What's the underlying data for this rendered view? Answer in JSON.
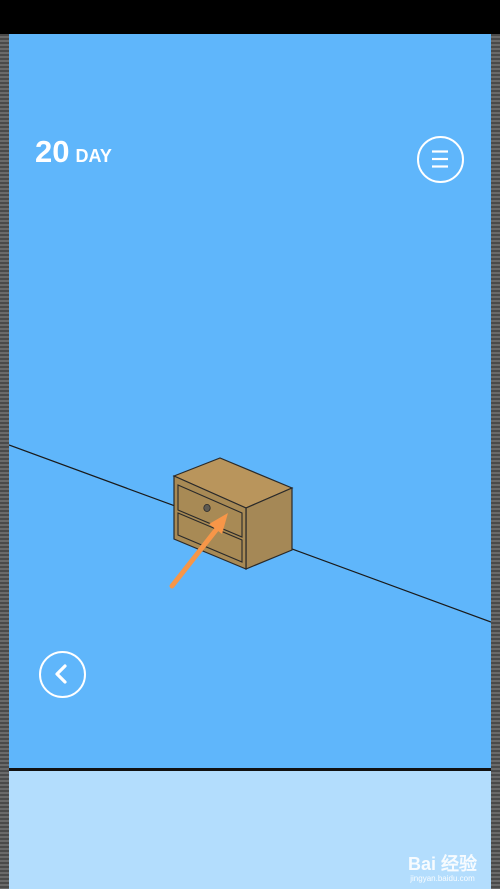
{
  "hud": {
    "day_number": "20",
    "day_label": "DAY"
  },
  "buttons": {
    "menu_icon": "hamburger-menu-icon",
    "back_icon": "chevron-left-icon"
  },
  "scene": {
    "object": "wooden-nightstand",
    "hint": "orange-arrow-pointing-at-drawer-knob"
  },
  "colors": {
    "sky": "#5fb6fb",
    "bottom_panel": "#b3ddfd",
    "cabinet_front": "#a88a55",
    "cabinet_top": "#b9955c",
    "cabinet_side": "#a58856",
    "hint_arrow": "#f79648"
  },
  "watermark": {
    "brand": "Bai 经验",
    "url": "jingyan.baidu.com"
  }
}
